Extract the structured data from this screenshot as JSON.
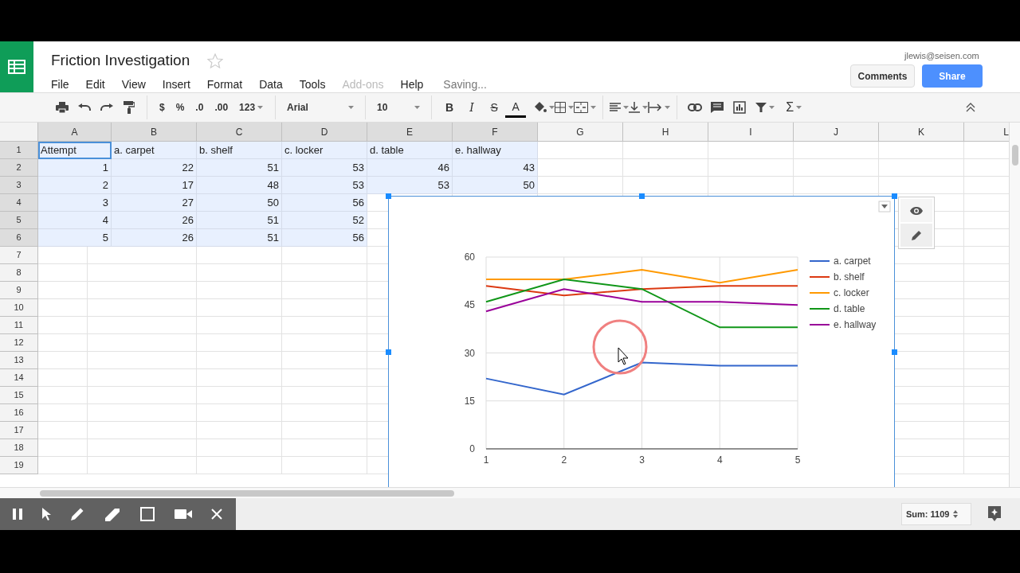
{
  "document": {
    "title": "Friction Investigation",
    "starred": false,
    "account": "jlewis@seisen.com",
    "status": "Saving..."
  },
  "menu": [
    {
      "label": "File",
      "disabled": false
    },
    {
      "label": "Edit",
      "disabled": false
    },
    {
      "label": "View",
      "disabled": false
    },
    {
      "label": "Insert",
      "disabled": false
    },
    {
      "label": "Format",
      "disabled": false
    },
    {
      "label": "Data",
      "disabled": false
    },
    {
      "label": "Tools",
      "disabled": false
    },
    {
      "label": "Add-ons",
      "disabled": true
    },
    {
      "label": "Help",
      "disabled": false
    }
  ],
  "buttons": {
    "comments": "Comments",
    "share": "Share"
  },
  "toolbar": {
    "format_buttons": [
      "$",
      "%",
      ".0",
      ".00",
      "123"
    ],
    "font": "Arial",
    "font_size": "10",
    "bold": "B",
    "italic": "I",
    "strike": "S",
    "text_color": "A",
    "functions": "Σ"
  },
  "columns": [
    {
      "label": "A",
      "selected": true
    },
    {
      "label": "B",
      "selected": true
    },
    {
      "label": "C",
      "selected": true
    },
    {
      "label": "D",
      "selected": true
    },
    {
      "label": "E",
      "selected": true
    },
    {
      "label": "F",
      "selected": true
    },
    {
      "label": "G",
      "selected": false
    },
    {
      "label": "H",
      "selected": false
    },
    {
      "label": "I",
      "selected": false
    },
    {
      "label": "J",
      "selected": false
    },
    {
      "label": "K",
      "selected": false
    },
    {
      "label": "L",
      "selected": false
    }
  ],
  "rows": [
    {
      "number": "1",
      "selected": true,
      "cells": [
        {
          "text": "Attempt",
          "kind": "text",
          "active": true
        },
        {
          "text": "a. carpet",
          "kind": "text",
          "active": false
        },
        {
          "text": "b. shelf",
          "kind": "text",
          "active": false
        },
        {
          "text": "c. locker",
          "kind": "text",
          "active": false
        },
        {
          "text": "d. table",
          "kind": "text",
          "active": false
        },
        {
          "text": "e. hallway",
          "kind": "text",
          "active": false
        }
      ]
    },
    {
      "number": "2",
      "selected": true,
      "cells": [
        {
          "text": "1",
          "kind": "number",
          "active": false
        },
        {
          "text": "22",
          "kind": "number",
          "active": false
        },
        {
          "text": "51",
          "kind": "number",
          "active": false
        },
        {
          "text": "53",
          "kind": "number",
          "active": false
        },
        {
          "text": "46",
          "kind": "number",
          "active": false
        },
        {
          "text": "43",
          "kind": "number",
          "active": false
        }
      ]
    },
    {
      "number": "3",
      "selected": true,
      "cells": [
        {
          "text": "2",
          "kind": "number",
          "active": false
        },
        {
          "text": "17",
          "kind": "number",
          "active": false
        },
        {
          "text": "48",
          "kind": "number",
          "active": false
        },
        {
          "text": "53",
          "kind": "number",
          "active": false
        },
        {
          "text": "53",
          "kind": "number",
          "active": false
        },
        {
          "text": "50",
          "kind": "number",
          "active": false
        }
      ]
    },
    {
      "number": "4",
      "selected": true,
      "cells": [
        {
          "text": "3",
          "kind": "number",
          "active": false
        },
        {
          "text": "27",
          "kind": "number",
          "active": false
        },
        {
          "text": "50",
          "kind": "number",
          "active": false
        },
        {
          "text": "56",
          "kind": "number",
          "active": false
        }
      ]
    },
    {
      "number": "5",
      "selected": true,
      "cells": [
        {
          "text": "4",
          "kind": "number",
          "active": false
        },
        {
          "text": "26",
          "kind": "number",
          "active": false
        },
        {
          "text": "51",
          "kind": "number",
          "active": false
        },
        {
          "text": "52",
          "kind": "number",
          "active": false
        }
      ]
    },
    {
      "number": "6",
      "selected": true,
      "cells": [
        {
          "text": "5",
          "kind": "number",
          "active": false
        },
        {
          "text": "26",
          "kind": "number",
          "active": false
        },
        {
          "text": "51",
          "kind": "number",
          "active": false
        },
        {
          "text": "56",
          "kind": "number",
          "active": false
        }
      ]
    },
    {
      "number": "7",
      "selected": false
    },
    {
      "number": "8",
      "selected": false
    },
    {
      "number": "9",
      "selected": false
    },
    {
      "number": "10",
      "selected": false
    },
    {
      "number": "11",
      "selected": false
    },
    {
      "number": "12",
      "selected": false
    },
    {
      "number": "13",
      "selected": false
    },
    {
      "number": "14",
      "selected": false
    },
    {
      "number": "15",
      "selected": false
    },
    {
      "number": "16",
      "selected": false
    },
    {
      "number": "17",
      "selected": false
    },
    {
      "number": "18",
      "selected": false
    },
    {
      "number": "19",
      "selected": false
    }
  ],
  "chart": {
    "chart_data": {
      "type": "line",
      "grid": true,
      "legend": "right",
      "categories": [
        "1",
        "2",
        "3",
        "4",
        "5"
      ],
      "ylim": [
        0,
        60
      ],
      "yticks": [
        0,
        15,
        30,
        45,
        60
      ],
      "series": [
        {
          "name": "a. carpet",
          "color": "#3366cc",
          "values": [
            22,
            17,
            27,
            26,
            26
          ]
        },
        {
          "name": "b. shelf",
          "color": "#dc3912",
          "values": [
            51,
            48,
            50,
            51,
            51
          ]
        },
        {
          "name": "c. locker",
          "color": "#ff9900",
          "values": [
            53,
            53,
            56,
            52,
            56
          ]
        },
        {
          "name": "d. table",
          "color": "#109618",
          "values": [
            46,
            53,
            50,
            38,
            38
          ]
        },
        {
          "name": "e. hallway",
          "color": "#990099",
          "values": [
            43,
            50,
            46,
            46,
            45
          ]
        }
      ]
    }
  },
  "status_bar": {
    "sum": "Sum: 1109"
  }
}
